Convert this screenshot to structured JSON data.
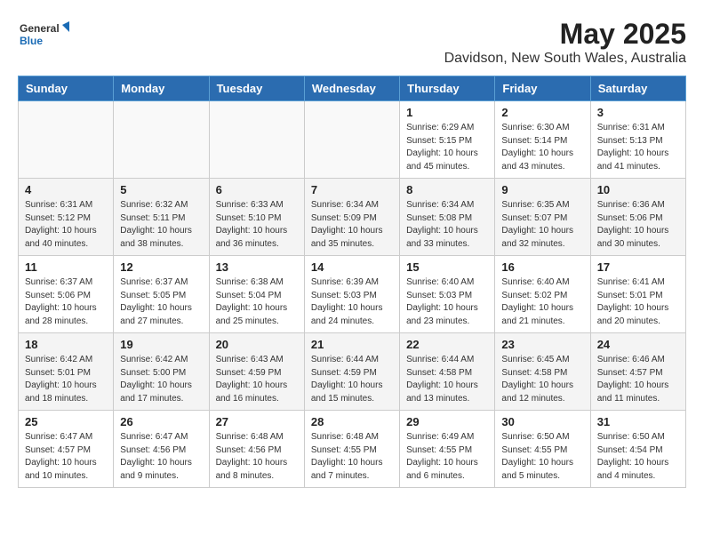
{
  "header": {
    "logo_general": "General",
    "logo_blue": "Blue",
    "title": "May 2025",
    "subtitle": "Davidson, New South Wales, Australia"
  },
  "calendar": {
    "weekdays": [
      "Sunday",
      "Monday",
      "Tuesday",
      "Wednesday",
      "Thursday",
      "Friday",
      "Saturday"
    ],
    "weeks": [
      [
        {
          "day": "",
          "info": ""
        },
        {
          "day": "",
          "info": ""
        },
        {
          "day": "",
          "info": ""
        },
        {
          "day": "",
          "info": ""
        },
        {
          "day": "1",
          "info": "Sunrise: 6:29 AM\nSunset: 5:15 PM\nDaylight: 10 hours\nand 45 minutes."
        },
        {
          "day": "2",
          "info": "Sunrise: 6:30 AM\nSunset: 5:14 PM\nDaylight: 10 hours\nand 43 minutes."
        },
        {
          "day": "3",
          "info": "Sunrise: 6:31 AM\nSunset: 5:13 PM\nDaylight: 10 hours\nand 41 minutes."
        }
      ],
      [
        {
          "day": "4",
          "info": "Sunrise: 6:31 AM\nSunset: 5:12 PM\nDaylight: 10 hours\nand 40 minutes."
        },
        {
          "day": "5",
          "info": "Sunrise: 6:32 AM\nSunset: 5:11 PM\nDaylight: 10 hours\nand 38 minutes."
        },
        {
          "day": "6",
          "info": "Sunrise: 6:33 AM\nSunset: 5:10 PM\nDaylight: 10 hours\nand 36 minutes."
        },
        {
          "day": "7",
          "info": "Sunrise: 6:34 AM\nSunset: 5:09 PM\nDaylight: 10 hours\nand 35 minutes."
        },
        {
          "day": "8",
          "info": "Sunrise: 6:34 AM\nSunset: 5:08 PM\nDaylight: 10 hours\nand 33 minutes."
        },
        {
          "day": "9",
          "info": "Sunrise: 6:35 AM\nSunset: 5:07 PM\nDaylight: 10 hours\nand 32 minutes."
        },
        {
          "day": "10",
          "info": "Sunrise: 6:36 AM\nSunset: 5:06 PM\nDaylight: 10 hours\nand 30 minutes."
        }
      ],
      [
        {
          "day": "11",
          "info": "Sunrise: 6:37 AM\nSunset: 5:06 PM\nDaylight: 10 hours\nand 28 minutes."
        },
        {
          "day": "12",
          "info": "Sunrise: 6:37 AM\nSunset: 5:05 PM\nDaylight: 10 hours\nand 27 minutes."
        },
        {
          "day": "13",
          "info": "Sunrise: 6:38 AM\nSunset: 5:04 PM\nDaylight: 10 hours\nand 25 minutes."
        },
        {
          "day": "14",
          "info": "Sunrise: 6:39 AM\nSunset: 5:03 PM\nDaylight: 10 hours\nand 24 minutes."
        },
        {
          "day": "15",
          "info": "Sunrise: 6:40 AM\nSunset: 5:03 PM\nDaylight: 10 hours\nand 23 minutes."
        },
        {
          "day": "16",
          "info": "Sunrise: 6:40 AM\nSunset: 5:02 PM\nDaylight: 10 hours\nand 21 minutes."
        },
        {
          "day": "17",
          "info": "Sunrise: 6:41 AM\nSunset: 5:01 PM\nDaylight: 10 hours\nand 20 minutes."
        }
      ],
      [
        {
          "day": "18",
          "info": "Sunrise: 6:42 AM\nSunset: 5:01 PM\nDaylight: 10 hours\nand 18 minutes."
        },
        {
          "day": "19",
          "info": "Sunrise: 6:42 AM\nSunset: 5:00 PM\nDaylight: 10 hours\nand 17 minutes."
        },
        {
          "day": "20",
          "info": "Sunrise: 6:43 AM\nSunset: 4:59 PM\nDaylight: 10 hours\nand 16 minutes."
        },
        {
          "day": "21",
          "info": "Sunrise: 6:44 AM\nSunset: 4:59 PM\nDaylight: 10 hours\nand 15 minutes."
        },
        {
          "day": "22",
          "info": "Sunrise: 6:44 AM\nSunset: 4:58 PM\nDaylight: 10 hours\nand 13 minutes."
        },
        {
          "day": "23",
          "info": "Sunrise: 6:45 AM\nSunset: 4:58 PM\nDaylight: 10 hours\nand 12 minutes."
        },
        {
          "day": "24",
          "info": "Sunrise: 6:46 AM\nSunset: 4:57 PM\nDaylight: 10 hours\nand 11 minutes."
        }
      ],
      [
        {
          "day": "25",
          "info": "Sunrise: 6:47 AM\nSunset: 4:57 PM\nDaylight: 10 hours\nand 10 minutes."
        },
        {
          "day": "26",
          "info": "Sunrise: 6:47 AM\nSunset: 4:56 PM\nDaylight: 10 hours\nand 9 minutes."
        },
        {
          "day": "27",
          "info": "Sunrise: 6:48 AM\nSunset: 4:56 PM\nDaylight: 10 hours\nand 8 minutes."
        },
        {
          "day": "28",
          "info": "Sunrise: 6:48 AM\nSunset: 4:55 PM\nDaylight: 10 hours\nand 7 minutes."
        },
        {
          "day": "29",
          "info": "Sunrise: 6:49 AM\nSunset: 4:55 PM\nDaylight: 10 hours\nand 6 minutes."
        },
        {
          "day": "30",
          "info": "Sunrise: 6:50 AM\nSunset: 4:55 PM\nDaylight: 10 hours\nand 5 minutes."
        },
        {
          "day": "31",
          "info": "Sunrise: 6:50 AM\nSunset: 4:54 PM\nDaylight: 10 hours\nand 4 minutes."
        }
      ]
    ]
  }
}
